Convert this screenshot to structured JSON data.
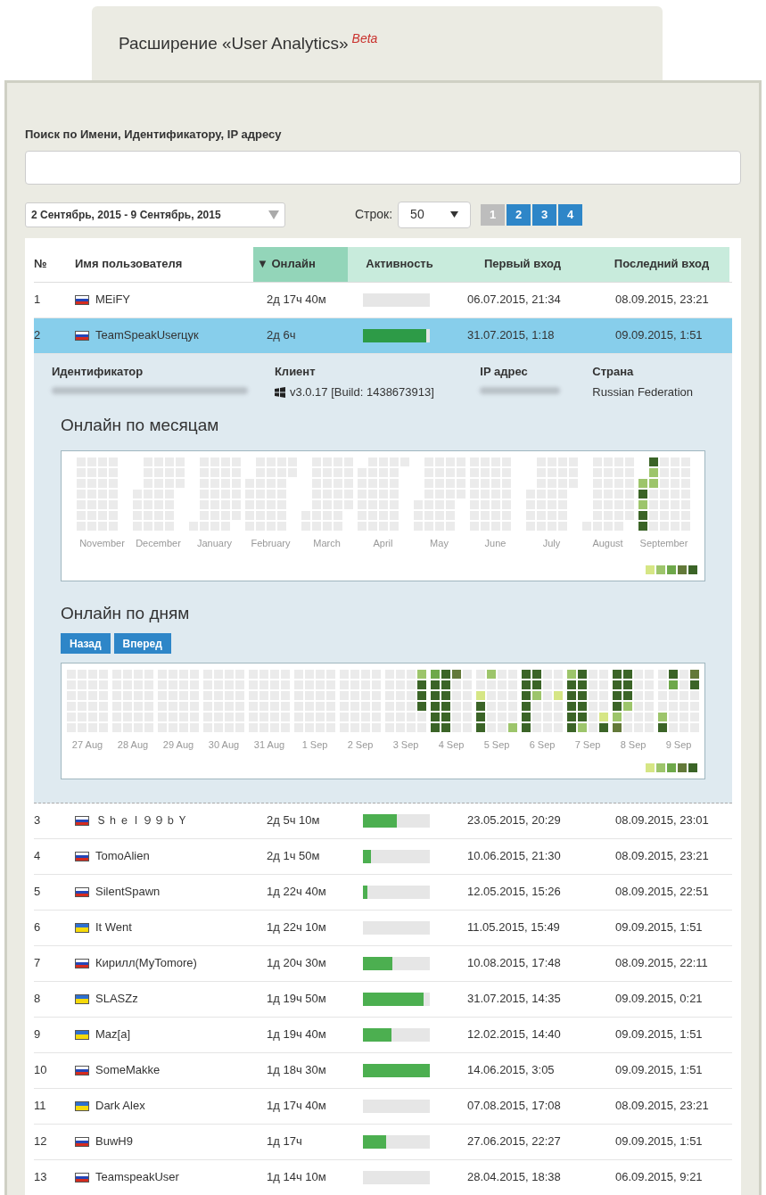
{
  "header": {
    "title": "Расширение «User Analytics»",
    "badge": "Beta"
  },
  "search": {
    "label": "Поиск по Имени, Идентификатору, IP адресу"
  },
  "date_range": {
    "value": "2 Сентябрь, 2015 - 9 Сентябрь, 2015"
  },
  "rows_per_page": {
    "label": "Строк:",
    "value": "50"
  },
  "pagination": [
    {
      "label": "1",
      "selected": true
    },
    {
      "label": "2",
      "selected": false
    },
    {
      "label": "3",
      "selected": false
    },
    {
      "label": "4",
      "selected": false
    }
  ],
  "table": {
    "columns": [
      {
        "label": "№",
        "sorted": false
      },
      {
        "label": "Имя пользователя",
        "sorted": false
      },
      {
        "label": "▼ Онлайн",
        "sorted": true
      },
      {
        "label": "Активность",
        "sorted": false
      },
      {
        "label": "Первый вход",
        "sorted": false
      },
      {
        "label": "Последний вход",
        "sorted": false
      }
    ],
    "rows": [
      {
        "number": "1",
        "kind": "ru",
        "name": "MEiFY",
        "online": "2д 17ч 40м",
        "level": 0,
        "first_login": "06.07.2015, 21:34",
        "last_login": "08.09.2015, 23:21",
        "selected": false
      },
      {
        "number": "2",
        "kind": "ru",
        "name": "TeamSpeakUserцук",
        "online": "2д 6ч",
        "level": 0.95,
        "first_login": "31.07.2015, 1:18",
        "last_login": "09.09.2015, 1:51",
        "selected": true,
        "expanded": true,
        "details": {
          "fields": [
            {
              "label": "Идентификатор",
              "kind": "redacted"
            },
            {
              "label": "Клиент",
              "kind": "client",
              "value": "v3.0.17 [Build: 1438673913]"
            },
            {
              "label": "IP адрес",
              "kind": "redacted"
            },
            {
              "label": "Страна",
              "kind": "text",
              "value": "Russian Federation"
            }
          ],
          "monthly": {
            "title": "Онлайн по месяцам",
            "months": [
              "November",
              "December",
              "January",
              "February",
              "March",
              "April",
              "May",
              "June",
              "July",
              "August",
              "September"
            ]
          },
          "daily": {
            "title": "Онлайн по дням",
            "buttons": [
              "Назад",
              "Вперед"
            ],
            "days": [
              "27 Aug",
              "28 Aug",
              "29 Aug",
              "30 Aug",
              "31 Aug",
              "1 Sep",
              "2 Sep",
              "3 Sep",
              "4 Sep",
              "5 Sep",
              "6 Sep",
              "7 Sep",
              "8 Sep",
              "9 Sep"
            ]
          }
        }
      },
      {
        "number": "3",
        "kind": "ru",
        "name": "Ｓｈｅｌ９９ｂＹ",
        "online": "2д 5ч 10м",
        "level": 0.5,
        "first_login": "23.05.2015, 20:29",
        "last_login": "08.09.2015, 23:01",
        "selected": false
      },
      {
        "number": "4",
        "kind": "ru",
        "name": "TomoAlien",
        "online": "2д 1ч 50м",
        "level": 0.12,
        "first_login": "10.06.2015, 21:30",
        "last_login": "08.09.2015, 23:21",
        "selected": false
      },
      {
        "number": "5",
        "kind": "ru",
        "name": "SilentSpawn",
        "online": "1д 22ч 40м",
        "level": 0.06,
        "first_login": "12.05.2015, 15:26",
        "last_login": "08.09.2015, 22:51",
        "selected": false
      },
      {
        "number": "6",
        "kind": "ua",
        "name": "It Went",
        "online": "1д 22ч 10м",
        "level": 0,
        "first_login": "11.05.2015, 15:49",
        "last_login": "09.09.2015, 1:51",
        "selected": false
      },
      {
        "number": "7",
        "kind": "ru",
        "name": "Кирилл(MyTomore)",
        "online": "1д 20ч 30м",
        "level": 0.44,
        "first_login": "10.08.2015, 17:48",
        "last_login": "08.09.2015, 22:11",
        "selected": false
      },
      {
        "number": "8",
        "kind": "ua",
        "name": "SLASZz",
        "online": "1д 19ч 50м",
        "level": 0.9,
        "first_login": "31.07.2015, 14:35",
        "last_login": "09.09.2015, 0:21",
        "selected": false
      },
      {
        "number": "9",
        "kind": "ua",
        "name": "Maz[a]",
        "online": "1д 19ч 40м",
        "level": 0.42,
        "first_login": "12.02.2015, 14:40",
        "last_login": "09.09.2015, 1:51",
        "selected": false
      },
      {
        "number": "10",
        "kind": "ru",
        "name": "SomeMakke",
        "online": "1д 18ч 30м",
        "level": 1,
        "first_login": "14.06.2015, 3:05",
        "last_login": "09.09.2015, 1:51",
        "selected": false
      },
      {
        "number": "11",
        "kind": "ua",
        "name": "Dark Alex",
        "online": "1д 17ч 40м",
        "level": 0,
        "first_login": "07.08.2015, 17:08",
        "last_login": "08.09.2015, 23:21",
        "selected": false
      },
      {
        "number": "12",
        "kind": "ru",
        "name": "BuwH9",
        "online": "1д 17ч",
        "level": 0.35,
        "first_login": "27.06.2015, 22:27",
        "last_login": "09.09.2015, 1:51",
        "selected": false
      },
      {
        "number": "13",
        "kind": "ru",
        "name": "TeamspeakUser",
        "online": "1д 14ч 10м",
        "level": 0,
        "first_login": "28.04.2015, 18:38",
        "last_login": "06.09.2015, 9:21",
        "selected": false
      }
    ]
  }
}
